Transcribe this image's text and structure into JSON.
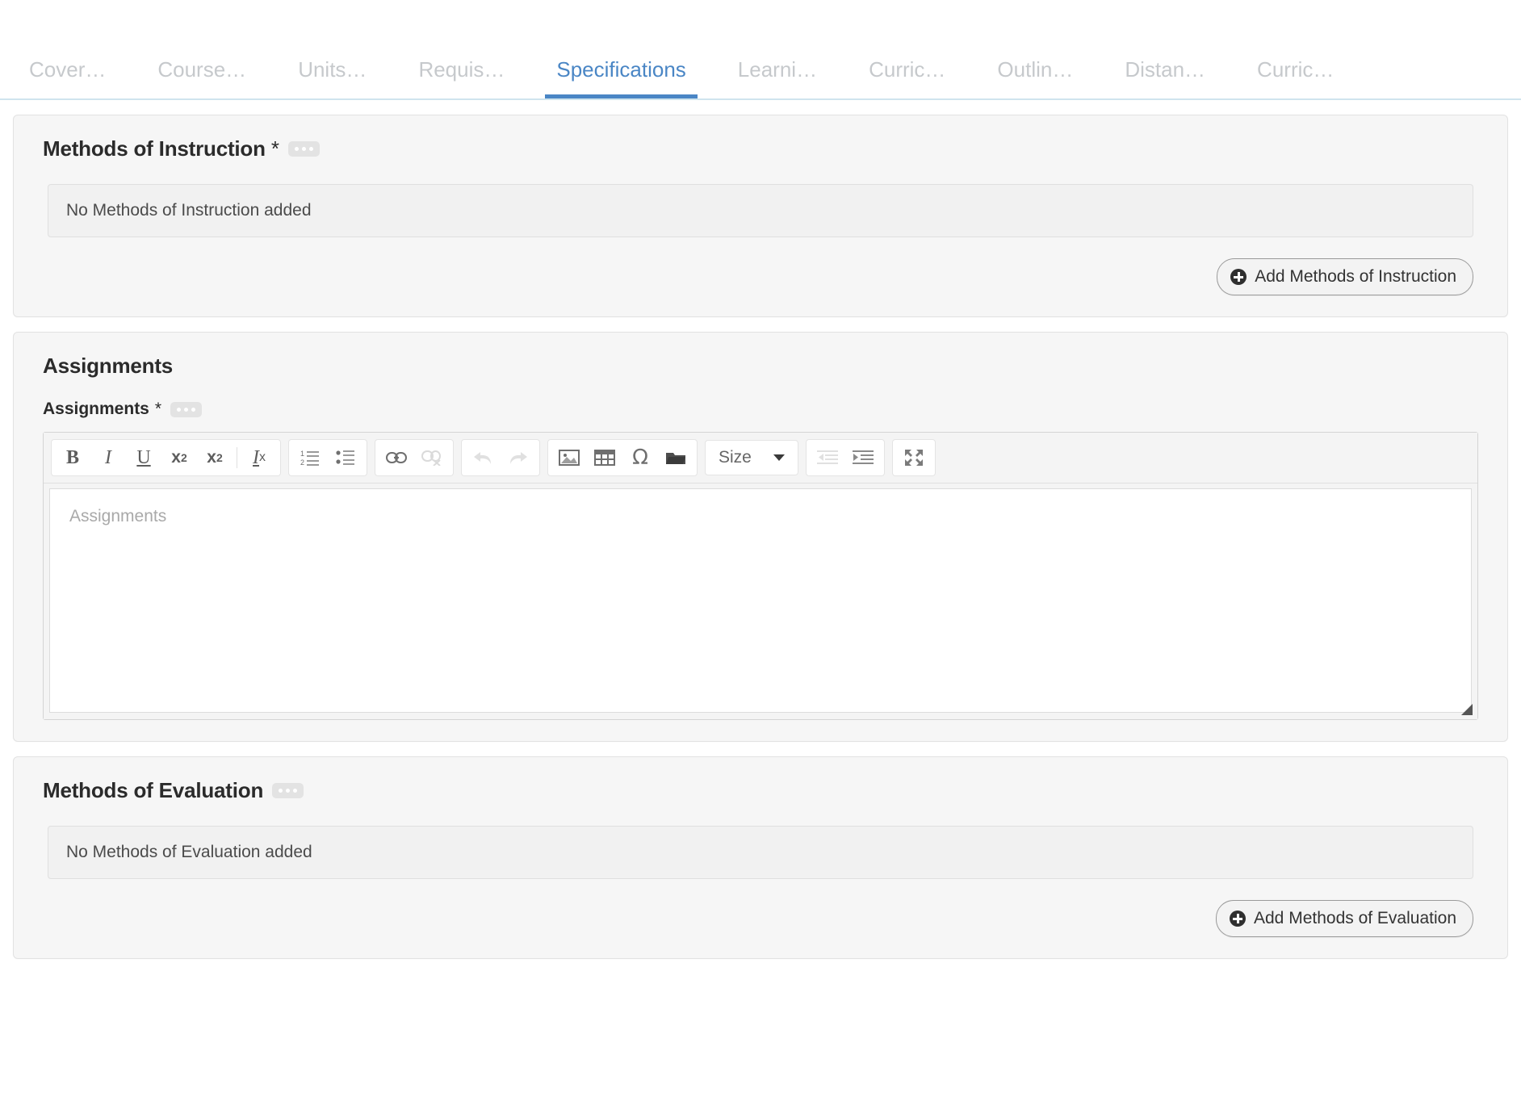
{
  "tabs": [
    {
      "label": "Cover…",
      "name": "tab-cover",
      "active": false
    },
    {
      "label": "Course…",
      "name": "tab-course",
      "active": false
    },
    {
      "label": "Units…",
      "name": "tab-units",
      "active": false
    },
    {
      "label": "Requis…",
      "name": "tab-requisites",
      "active": false
    },
    {
      "label": "Specifications",
      "name": "tab-specifications",
      "active": true
    },
    {
      "label": "Learni…",
      "name": "tab-learning",
      "active": false
    },
    {
      "label": "Curric…",
      "name": "tab-curriculum-1",
      "active": false
    },
    {
      "label": "Outlin…",
      "name": "tab-outline",
      "active": false
    },
    {
      "label": "Distan…",
      "name": "tab-distance",
      "active": false
    },
    {
      "label": "Curric…",
      "name": "tab-curriculum-2",
      "active": false
    }
  ],
  "accent_color": "#4a86c5",
  "panel_background": "#f6f6f6",
  "methods_of_instruction": {
    "title": "Methods of Instruction",
    "required_marker": "*",
    "info_badge_icon": "ellipsis-icon",
    "empty_text": "No Methods of Instruction added",
    "add_button_label": "Add Methods of Instruction",
    "add_button_icon": "plus-circle-icon"
  },
  "assignments": {
    "section_title": "Assignments",
    "field_label": "Assignments",
    "required_marker": "*",
    "info_badge_icon": "ellipsis-icon",
    "editor_placeholder": "Assignments",
    "editor_value": "",
    "toolbar": {
      "size_label": "Size",
      "groups": [
        {
          "name": "text-format-group",
          "buttons": [
            {
              "name": "bold-button",
              "icon": "bold-icon",
              "glyph": "B",
              "dim": false
            },
            {
              "name": "italic-button",
              "icon": "italic-icon",
              "glyph": "I",
              "dim": false
            },
            {
              "name": "underline-button",
              "icon": "underline-icon",
              "glyph": "U",
              "dim": false
            },
            {
              "name": "subscript-button",
              "icon": "subscript-icon",
              "glyph": "x₂",
              "dim": false
            },
            {
              "name": "superscript-button",
              "icon": "superscript-icon",
              "glyph": "x²",
              "dim": false
            },
            {
              "name": "separator",
              "icon": "divider",
              "glyph": "",
              "dim": false
            },
            {
              "name": "remove-format-button",
              "icon": "remove-format-icon",
              "glyph": "Iₓ",
              "dim": false
            }
          ]
        },
        {
          "name": "list-group",
          "buttons": [
            {
              "name": "numbered-list-button",
              "icon": "numbered-list-icon",
              "dim": false
            },
            {
              "name": "bulleted-list-button",
              "icon": "bulleted-list-icon",
              "dim": false
            }
          ]
        },
        {
          "name": "link-group",
          "buttons": [
            {
              "name": "link-button",
              "icon": "link-icon",
              "dim": false
            },
            {
              "name": "unlink-button",
              "icon": "unlink-icon",
              "dim": true
            }
          ]
        },
        {
          "name": "history-group",
          "buttons": [
            {
              "name": "undo-button",
              "icon": "undo-arrow-icon",
              "dim": true
            },
            {
              "name": "redo-button",
              "icon": "redo-arrow-icon",
              "dim": true
            }
          ]
        },
        {
          "name": "insert-group",
          "buttons": [
            {
              "name": "insert-image-button",
              "icon": "image-icon",
              "dim": false
            },
            {
              "name": "insert-table-button",
              "icon": "table-icon",
              "dim": false
            },
            {
              "name": "special-character-button",
              "icon": "omega-icon",
              "dim": false
            },
            {
              "name": "browse-server-button",
              "icon": "folder-icon",
              "dim": false
            }
          ]
        },
        {
          "name": "indent-group",
          "buttons": [
            {
              "name": "outdent-button",
              "icon": "outdent-icon",
              "dim": true
            },
            {
              "name": "indent-button",
              "icon": "indent-icon",
              "dim": false
            }
          ]
        },
        {
          "name": "maximize-group",
          "buttons": [
            {
              "name": "maximize-button",
              "icon": "maximize-icon",
              "dim": false
            }
          ]
        }
      ]
    }
  },
  "methods_of_evaluation": {
    "title": "Methods of Evaluation",
    "info_badge_icon": "ellipsis-icon",
    "empty_text": "No Methods of Evaluation added",
    "add_button_label": "Add Methods of Evaluation",
    "add_button_icon": "plus-circle-icon"
  }
}
